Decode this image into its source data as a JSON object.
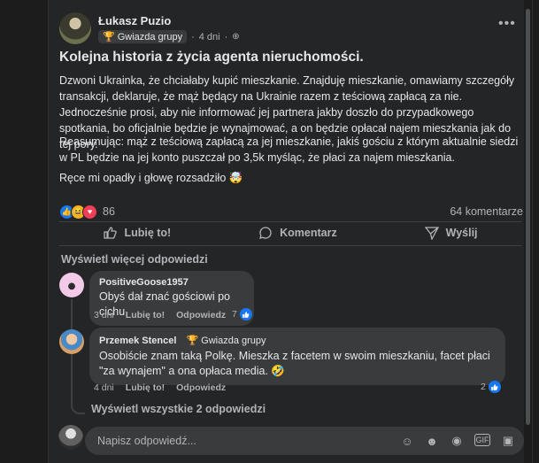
{
  "post": {
    "author": "Łukasz Puzio",
    "badge": "Gwiazda grupy",
    "time": "4 dni",
    "title": "Kolejna historia z życia agenta nieruchomości.",
    "paragraphs": [
      "Dzwoni Ukrainka, że chciałaby kupić mieszkanie. Znajduję mieszkanie, omawiamy szczegóły transakcji, deklaruje, że mąż będący na Ukrainie razem z teściową zapłacą za nie. Jednocześnie prosi, aby nie informować jej partnera jakby doszło do przypadkowego spotkania, bo oficjalnie będzie je wynajmować, a on będzie opłacał najem mieszkania jak do tej pory.",
      "Reasumując: mąż z teściową zapłacą za jej mieszkanie, jakiś gościu z którym aktualnie siedzi w PL będzie na jej konto puszczał po 3,5k myśląc, że płaci za najem mieszkania.",
      "Ręce mi opadły i głowę rozsadziło 🤯"
    ],
    "reaction_count": "86",
    "comment_count": "64 komentarze"
  },
  "actions": {
    "like": "Lubię to!",
    "comment": "Komentarz",
    "share": "Wyślij"
  },
  "more_replies": "Wyświetl więcej odpowiedzi",
  "comments": [
    {
      "name": "PositiveGoose1957",
      "text": "Obyś dał znać gościowi po cichu",
      "time": "3 dni",
      "like": "Lubię to!",
      "reply": "Odpowiedz",
      "likes": "7"
    },
    {
      "name": "Przemek Stencel",
      "badge": "Gwiazda grupy",
      "text": "Osobiście znam taką Polkę. Mieszka z facetem w swoim mieszkaniu, facet płaci \"za wynajem\" a ona opłaca media. 🤣",
      "time": "4 dni",
      "like": "Lubię to!",
      "reply": "Odpowiedz",
      "likes": "2"
    }
  ],
  "show_all_replies": "Wyświetl wszystkie 2 odpowiedzi",
  "reply_placeholder": "Napisz odpowiedź...",
  "colors": {
    "card": "#242526",
    "bubble": "#3a3b3c",
    "like_blue": "#1877f2"
  }
}
